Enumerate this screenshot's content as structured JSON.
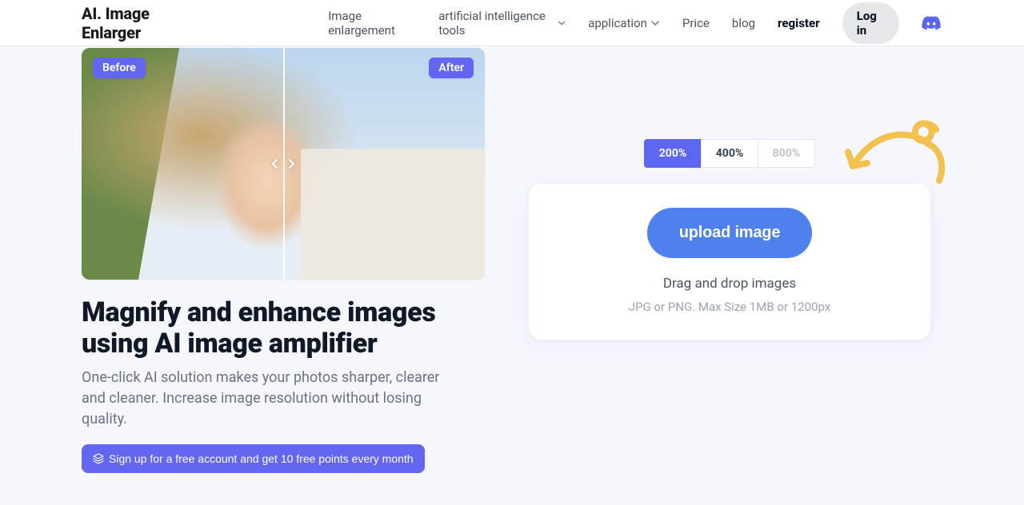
{
  "brand": "AI. Image Enlarger",
  "nav": {
    "enlargement": "Image enlargement",
    "ai_tools": "artificial intelligence tools",
    "application": "application",
    "price": "Price",
    "blog": "blog",
    "register": "register",
    "login": "Log in"
  },
  "hero": {
    "before": "Before",
    "after": "After"
  },
  "headline_l1": "Magnify and enhance images",
  "headline_l2": "using AI image amplifier",
  "subcopy": "One-click AI solution makes your photos sharper, clearer and cleaner. Increase image resolution without losing quality.",
  "signup_cta": "Sign up for a free account and get 10 free points every month",
  "zoom": {
    "options": [
      "200%",
      "400%",
      "800%"
    ],
    "active_index": 0
  },
  "upload": {
    "button": "upload image",
    "dnd": "Drag and drop images",
    "hint": "JPG or PNG. Max Size 1MB or 1200px"
  }
}
